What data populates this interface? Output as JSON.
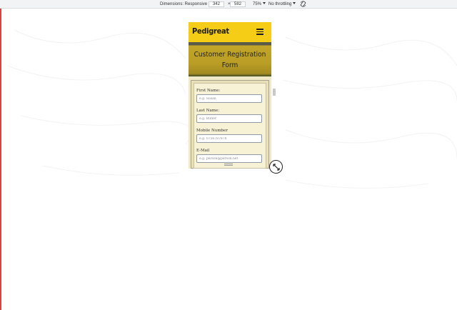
{
  "devtools": {
    "dimensions_label": "Dimensions: Responsive",
    "width": "342",
    "times": "×",
    "height": "582",
    "zoom": "75%",
    "throttling": "No throttling",
    "rotate_icon": "rotate-icon"
  },
  "site": {
    "brand": "Pedigreat",
    "menu_icon": "hamburger-menu-icon",
    "hero_title_line1": "Customer Registration",
    "hero_title_line2": "Form",
    "colors": {
      "navbar": "#f5cc16",
      "form_bg": "#f7f1d6"
    }
  },
  "form": {
    "fields": [
      {
        "label": "First Name:",
        "placeholder": "e.g. Susan"
      },
      {
        "label": "Last Name:",
        "placeholder": "e.g. Butler"
      },
      {
        "label": "Mobile Number",
        "placeholder": "e.g. 0756787878"
      },
      {
        "label": "E-Mail",
        "placeholder": "e.g. person@person.net"
      }
    ]
  },
  "resize_handle_icon": "resize-icon"
}
